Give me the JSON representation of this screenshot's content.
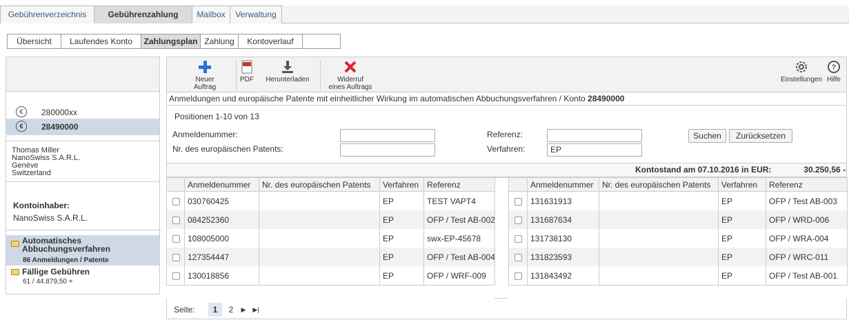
{
  "topnav": {
    "tabs": [
      {
        "label": "Gebührenverzeichnis",
        "active": false
      },
      {
        "label": "Gebührenzahlung",
        "active": true
      },
      {
        "label": "Mailbox",
        "active": false
      },
      {
        "label": "Verwaltung",
        "active": false
      }
    ]
  },
  "subnav": {
    "tabs": [
      {
        "label": "Übersicht",
        "active": false
      },
      {
        "label": "Laufendes Konto",
        "active": false
      },
      {
        "label": "Zahlungsplan",
        "active": true
      },
      {
        "label": "Zahlung",
        "active": false
      },
      {
        "label": "Kontoverlauf",
        "active": false
      }
    ]
  },
  "sidebar": {
    "accounts": [
      {
        "number": "280000xx",
        "selected": false
      },
      {
        "number": "28490000",
        "selected": true
      }
    ],
    "address": [
      "Thomas Miller",
      "NanoSwiss S.A.R.L.",
      "Genève",
      "Switzerland"
    ],
    "holder_label": "Kontoinhaber:",
    "holder_name": "NanoSwiss S.A.R.L.",
    "auto_title": "Automatisches Abbuchungsverfahren",
    "auto_sub": "86  Anmeldungen / Patente",
    "due_title": "Fällige Gebühren",
    "due_sub": "61  / 44.879,50 +"
  },
  "toolbar": {
    "new_label_1": "Neuer",
    "new_label_2": "Auftrag",
    "pdf_label": "PDF",
    "download_label": "Herunterladen",
    "revoke_label_1": "Widerruf",
    "revoke_label_2": "eines Auftrags",
    "settings_label": "Einstellungen",
    "help_label": "Hilfe"
  },
  "title": {
    "text": "Anmeldungen und europäische Patente mit einheitlicher Wirkung im automatischen Abbuchungsverfahren / Konto ",
    "account": "28490000"
  },
  "filter": {
    "positions": "Positionen 1-10 von 13",
    "app_label": "Anmeldenummer:",
    "app_value": "",
    "patent_label": "Nr. des europäischen Patents:",
    "patent_value": "",
    "ref_label": "Referenz:",
    "ref_value": "",
    "proc_label": "Verfahren:",
    "proc_value": "EP",
    "search_label": "Suchen",
    "reset_label": "Zurücksetzen"
  },
  "balance": {
    "label": "Kontostand am 07.10.2016 in EUR:",
    "value": "30.250,56 -"
  },
  "table": {
    "headers": [
      "Anmeldenummer",
      "Nr. des europäischen Patents",
      "Verfahren",
      "Referenz"
    ],
    "left": [
      {
        "app": "030760425",
        "patent": "",
        "proc": "EP",
        "ref": "TEST VAPT4"
      },
      {
        "app": "084252360",
        "patent": "",
        "proc": "EP",
        "ref": "OFP / Test AB-002"
      },
      {
        "app": "108005000",
        "patent": "",
        "proc": "EP",
        "ref": "swx-EP-45678"
      },
      {
        "app": "127354447",
        "patent": "",
        "proc": "EP",
        "ref": "OFP / Test AB-004"
      },
      {
        "app": "130018856",
        "patent": "",
        "proc": "EP",
        "ref": "OFP / WRF-009"
      }
    ],
    "right": [
      {
        "app": "131631913",
        "patent": "",
        "proc": "EP",
        "ref": "OFP / Test AB-003"
      },
      {
        "app": "131687634",
        "patent": "",
        "proc": "EP",
        "ref": "OFP / WRD-006"
      },
      {
        "app": "131738130",
        "patent": "",
        "proc": "EP",
        "ref": "OFP / WRA-004"
      },
      {
        "app": "131823593",
        "patent": "",
        "proc": "EP",
        "ref": "OFP / WRC-011"
      },
      {
        "app": "131843492",
        "patent": "",
        "proc": "EP",
        "ref": "OFP / Test AB-001"
      }
    ]
  },
  "pager": {
    "label": "Seite:",
    "pages": [
      "1",
      "2"
    ],
    "current": "1",
    "next_icon": "next-page-icon",
    "last_icon": "last-page-icon"
  }
}
